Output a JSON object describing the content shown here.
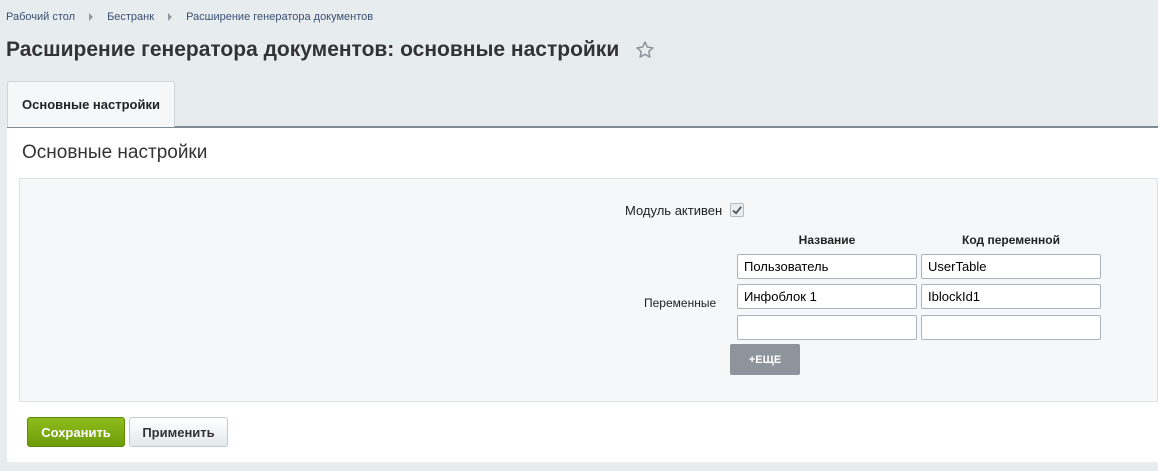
{
  "breadcrumb": [
    "Рабочий стол",
    "Бестранк",
    "Расширение генератора документов"
  ],
  "title": "Расширение генератора документов: основные настройки",
  "tab_label": "Основные настройки",
  "section_heading": "Основные настройки",
  "form": {
    "module_active_label": "Модуль активен",
    "module_active_checked": true,
    "variables_label": "Переменные",
    "col_name": "Название",
    "col_code": "Код переменной",
    "rows": [
      {
        "name": "Пользователь",
        "code": "UserTable"
      },
      {
        "name": "Инфоблок 1",
        "code": "IblockId1"
      },
      {
        "name": "",
        "code": ""
      }
    ],
    "more_label": "+ЕЩЕ"
  },
  "buttons": {
    "save": "Сохранить",
    "apply": "Применить"
  },
  "colors": {
    "accent_save": "#7aa80f",
    "background": "#e7ecef"
  }
}
